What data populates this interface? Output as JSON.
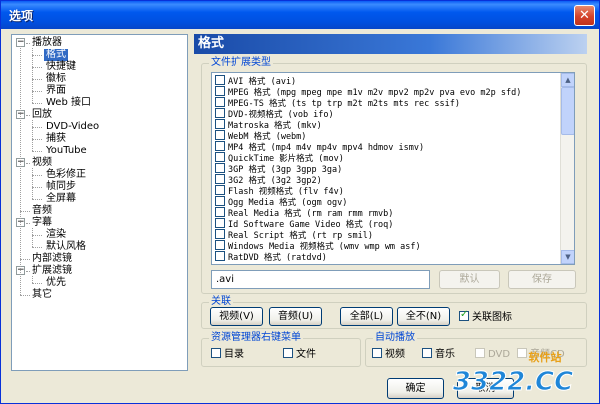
{
  "window": {
    "title": "选项",
    "close_glyph": "✕"
  },
  "tree": {
    "items": [
      {
        "label": "播放器",
        "level": 0,
        "expanded": true
      },
      {
        "label": "格式",
        "level": 1,
        "selected": true
      },
      {
        "label": "快捷键",
        "level": 1
      },
      {
        "label": "徽标",
        "level": 1
      },
      {
        "label": "界面",
        "level": 1
      },
      {
        "label": "Web 接口",
        "level": 1
      },
      {
        "label": "回放",
        "level": 0,
        "expanded": true
      },
      {
        "label": "DVD-Video",
        "level": 1
      },
      {
        "label": "捕获",
        "level": 1
      },
      {
        "label": "YouTube",
        "level": 1
      },
      {
        "label": "视频",
        "level": 0,
        "expanded": true
      },
      {
        "label": "色彩修正",
        "level": 1
      },
      {
        "label": "帧同步",
        "level": 1
      },
      {
        "label": "全屏幕",
        "level": 1
      },
      {
        "label": "音频",
        "level": 0
      },
      {
        "label": "字幕",
        "level": 0,
        "expanded": true
      },
      {
        "label": "渲染",
        "level": 1
      },
      {
        "label": "默认风格",
        "level": 1
      },
      {
        "label": "内部滤镜",
        "level": 0
      },
      {
        "label": "扩展滤镜",
        "level": 0,
        "expanded": true
      },
      {
        "label": "优先",
        "level": 1
      },
      {
        "label": "其它",
        "level": 0
      }
    ]
  },
  "page": {
    "title": "格式"
  },
  "file_types": {
    "group_label": "文件扩展类型",
    "items": [
      "AVI 格式 (avi)",
      "MPEG 格式 (mpg mpeg mpe m1v m2v mpv2 mp2v pva evo m2p sfd)",
      "MPEG-TS 格式 (ts tp trp m2t m2ts mts rec ssif)",
      "DVD-视频格式 (vob ifo)",
      "Matroska 格式 (mkv)",
      "WebM 格式 (webm)",
      "MP4 格式 (mp4 m4v mp4v mpv4 hdmov ismv)",
      "QuickTime 影片格式 (mov)",
      "3GP 格式 (3gp 3gpp 3ga)",
      "3G2 格式 (3g2 3gp2)",
      "Flash 视频格式 (flv f4v)",
      "Ogg Media 格式 (ogm ogv)",
      "Real Media 格式 (rm ram rmm rmvb)",
      "Id Software Game Video 格式 (roq)",
      "Real Script 格式 (rt rp smil)",
      "Windows Media 视频格式 (wmv wmp wm asf)",
      "RatDVD 格式 (ratdvd)"
    ],
    "ext_value": ".avi",
    "default_label": "默认",
    "save_label": "保存"
  },
  "assoc": {
    "group_label": "关联",
    "video_label": "视频(V)",
    "audio_label": "音频(U)",
    "all_label": "全部(L)",
    "none_label": "全不(N)",
    "icon_label": "关联图标"
  },
  "explorer_menu": {
    "group_label": "资源管理器右键菜单",
    "dir_label": "目录",
    "file_label": "文件"
  },
  "autoplay": {
    "group_label": "自动播放",
    "video_label": "视频",
    "audio_label": "音乐",
    "dvd_label": "DVD",
    "audiocd_label": "音频CD"
  },
  "footer": {
    "ok_label": "确定",
    "cancel_label": "取消"
  },
  "watermark": {
    "top_text": "软件站",
    "main_text": "3322.CC"
  }
}
